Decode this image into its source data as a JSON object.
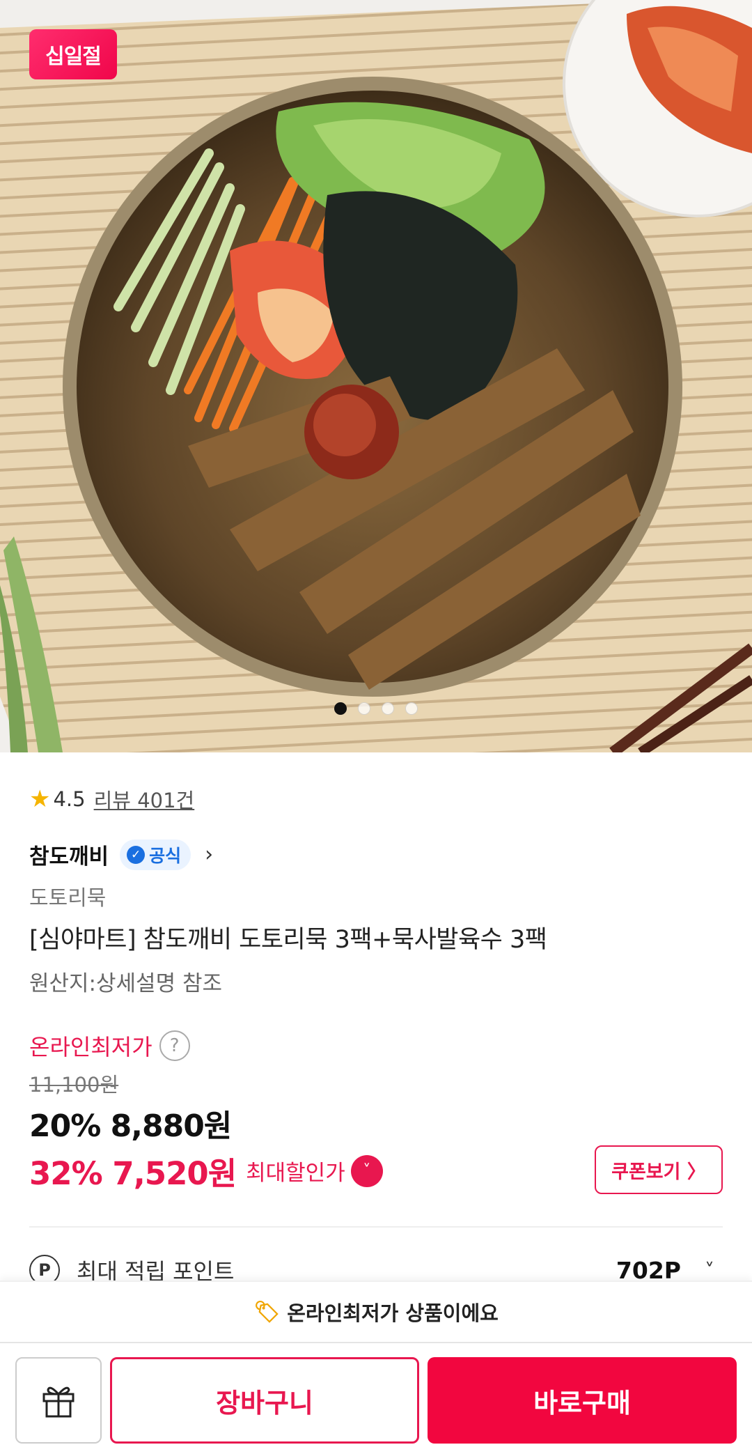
{
  "hero": {
    "badge": "십일절",
    "carousel_dots": 4,
    "active_dot": 0
  },
  "rating": {
    "star_icon": "star-icon",
    "score": "4.5",
    "reviews": "리뷰 401건"
  },
  "brand": {
    "name": "참도깨비",
    "official_label": "공식",
    "official_icon": "verified-check-icon",
    "chevron_icon": "chevron-right-icon"
  },
  "product": {
    "category": "도토리묵",
    "title": "[심야마트] 참도깨비 도토리묵 3팩+묵사발육수 3팩",
    "origin": "원산지:상세설명 참조"
  },
  "price": {
    "lowest_label": "온라인최저가",
    "help_icon": "?",
    "original": "11,100원",
    "discount": "20% 8,880원",
    "max_discount": "32% 7,520원",
    "max_label": "최대할인가",
    "max_chevron": "˅",
    "coupon_button": "쿠폰보기 〉"
  },
  "points": {
    "icon": "P",
    "label": "최대 적립 포인트",
    "value": "702P",
    "chevron": "˅"
  },
  "notice": {
    "icon": "tag-icon",
    "glyph": "🏷",
    "text": "온라인최저가 상품이에요"
  },
  "actions": {
    "gift_icon": "gift-icon",
    "cart": "장바구니",
    "buy": "바로구매"
  },
  "colors": {
    "accent": "#e8174f",
    "buy": "#f2063f",
    "official": "#1a6fe0",
    "star": "#f5b400"
  }
}
